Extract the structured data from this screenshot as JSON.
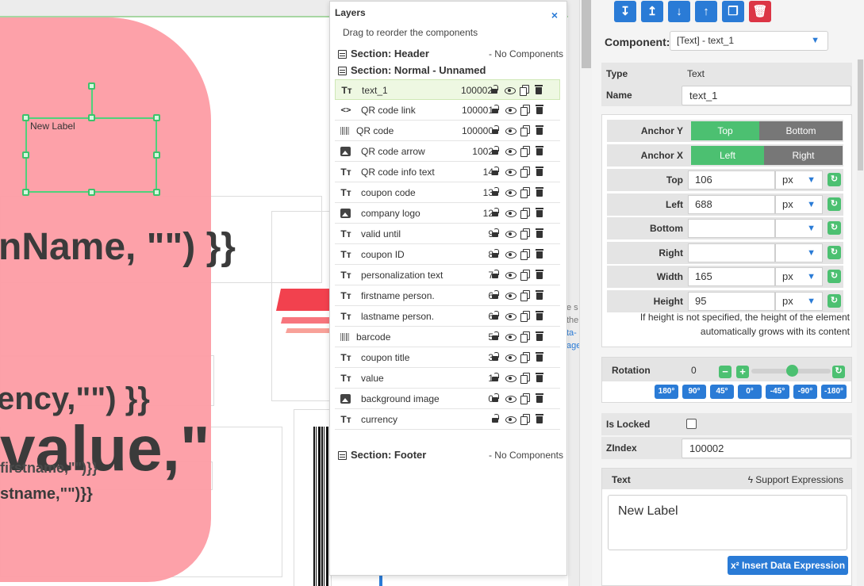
{
  "canvas": {
    "new_label": "New Label",
    "firstname_expr": "firstname,\"\")}}",
    "name_expr": "nName, \"\") }}",
    "currency_expr": "ency,\"\") }}",
    "value_expr": "value,\"",
    "lastname_expr": "stname,\"\")}}",
    "hint_lines": [
      "e s",
      "the",
      "ta-",
      "age"
    ],
    "colors": {
      "pink": "#fd9ca4",
      "selection": "#4fd17b",
      "logo_red": "#f2414e",
      "logo_pink": "#f8a199"
    }
  },
  "layers": {
    "title": "Layers",
    "close_icon": "×",
    "subtitle": "Drag to reorder the components",
    "sections": {
      "header": {
        "label": "Section: Header",
        "note": "- No Components"
      },
      "normal": {
        "label": "Section: Normal - Unnamed"
      },
      "footer": {
        "label": "Section: Footer",
        "note": "- No Components"
      }
    },
    "items": [
      {
        "icon": "text-icon",
        "glyph": "Tт",
        "name": "text_1",
        "z": "100002",
        "selected": true
      },
      {
        "icon": "code-icon",
        "glyph": "<>",
        "name": "QR code link",
        "z": "100001"
      },
      {
        "icon": "barcode-icon",
        "glyph": "",
        "name": "QR code",
        "z": "100000"
      },
      {
        "icon": "image-icon",
        "glyph": "",
        "name": "QR code arrow",
        "z": "1002"
      },
      {
        "icon": "text-icon",
        "glyph": "Tт",
        "name": "QR code info text",
        "z": "14"
      },
      {
        "icon": "text-icon",
        "glyph": "Tт",
        "name": "coupon code",
        "z": "13"
      },
      {
        "icon": "image-icon",
        "glyph": "",
        "name": "company logo",
        "z": "12"
      },
      {
        "icon": "text-icon",
        "glyph": "Tт",
        "name": "valid until",
        "z": "9"
      },
      {
        "icon": "text-icon",
        "glyph": "Tт",
        "name": "coupon ID",
        "z": "8"
      },
      {
        "icon": "text-icon",
        "glyph": "Tт",
        "name": "personalization text",
        "z": "7"
      },
      {
        "icon": "text-icon",
        "glyph": "Tт",
        "name": "firstname person.",
        "z": "6"
      },
      {
        "icon": "text-icon",
        "glyph": "Tт",
        "name": "lastname person.",
        "z": "6"
      },
      {
        "icon": "barcode-icon",
        "glyph": "",
        "name": "barcode",
        "z": "5"
      },
      {
        "icon": "text-icon",
        "glyph": "Tт",
        "name": "coupon title",
        "z": "3"
      },
      {
        "icon": "text-icon",
        "glyph": "Tт",
        "name": "value",
        "z": "1"
      },
      {
        "icon": "image-icon",
        "glyph": "",
        "name": "background image",
        "z": "0"
      },
      {
        "icon": "text-icon",
        "glyph": "Tт",
        "name": "currency",
        "z": ""
      }
    ]
  },
  "toolbar": {
    "buttons": [
      {
        "name": "move-to-front",
        "glyph": "↧"
      },
      {
        "name": "move-to-back",
        "glyph": "↥"
      },
      {
        "name": "move-down",
        "glyph": "↓"
      },
      {
        "name": "move-up",
        "glyph": "↑"
      },
      {
        "name": "duplicate",
        "glyph": "❐"
      },
      {
        "name": "delete",
        "glyph": "🗑"
      }
    ]
  },
  "props": {
    "component_label": "Component:",
    "component_value": "[Text] - text_1",
    "type_label": "Type",
    "type_value": "Text",
    "name_label": "Name",
    "name_value": "text_1",
    "anchor_y": {
      "label": "Anchor Y",
      "options": [
        "Top",
        "Bottom"
      ],
      "selected": "Top"
    },
    "anchor_x": {
      "label": "Anchor X",
      "options": [
        "Left",
        "Right"
      ],
      "selected": "Left"
    },
    "position": [
      {
        "label": "Top",
        "value": "106",
        "unit": "px"
      },
      {
        "label": "Left",
        "value": "688",
        "unit": "px"
      },
      {
        "label": "Bottom",
        "value": "",
        "unit": ""
      },
      {
        "label": "Right",
        "value": "",
        "unit": ""
      },
      {
        "label": "Width",
        "value": "165",
        "unit": "px"
      },
      {
        "label": "Height",
        "value": "95",
        "unit": "px"
      }
    ],
    "height_note": "If height is not specified, the height of the element automatically grows with its content",
    "rotation": {
      "label": "Rotation",
      "value": "0",
      "presets": [
        "180°",
        "90°",
        "45°",
        "0°",
        "-45°",
        "-90°",
        "-180°"
      ]
    },
    "locked_label": "Is Locked",
    "zindex_label": "ZIndex",
    "zindex_value": "100002",
    "text_label": "Text",
    "support_expr": "Support Expressions",
    "text_value": "New Label",
    "insert_expr": "Insert Data Expression"
  }
}
